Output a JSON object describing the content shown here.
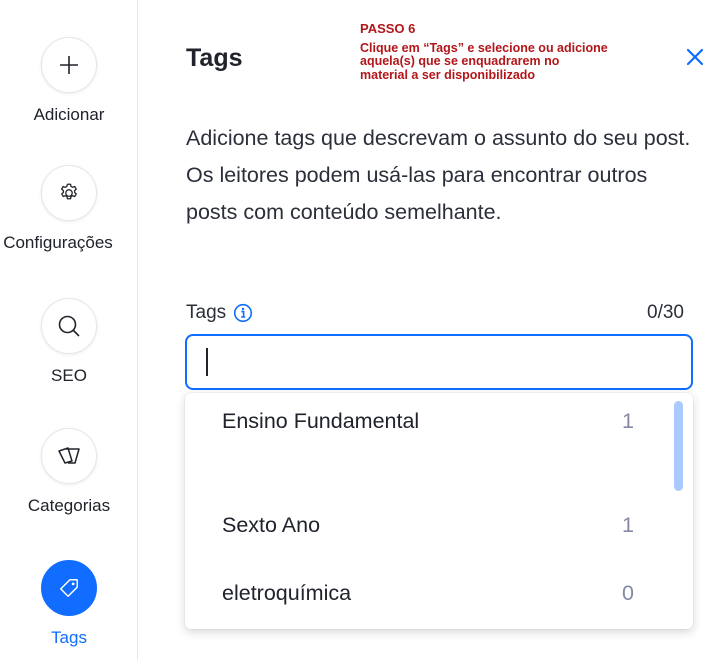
{
  "sidebar": {
    "items": [
      {
        "label": "Adicionar",
        "icon": "plus-icon"
      },
      {
        "label": "Configurações",
        "icon": "gear-icon"
      },
      {
        "label": "SEO",
        "icon": "search-icon"
      },
      {
        "label": "Categorias",
        "icon": "categories-icon"
      },
      {
        "label": "Tags",
        "icon": "tag-icon",
        "active": true
      }
    ]
  },
  "annotation": {
    "step": "PASSO 6",
    "text": "Clique em “Tags” e selecione ou adicione aquela(s) que se enquadrarem no material a ser disponibilizado"
  },
  "panel": {
    "title": "Tags",
    "description": "Adicione tags que descrevam o assunto do seu post. Os leitores podem usá-las para encontrar outros posts com conteúdo semelhante.",
    "field_label": "Tags",
    "counter": "0/30",
    "input_value": ""
  },
  "dropdown": {
    "options": [
      {
        "label": "Ensino Fundamental",
        "count": "1"
      },
      {
        "label": "Sexto Ano",
        "count": "1"
      },
      {
        "label": "eletroquímica",
        "count": "0"
      }
    ]
  },
  "colors": {
    "accent": "#116dff",
    "annotation": "#b2161a",
    "scrollbar": "#a9c9ff"
  }
}
